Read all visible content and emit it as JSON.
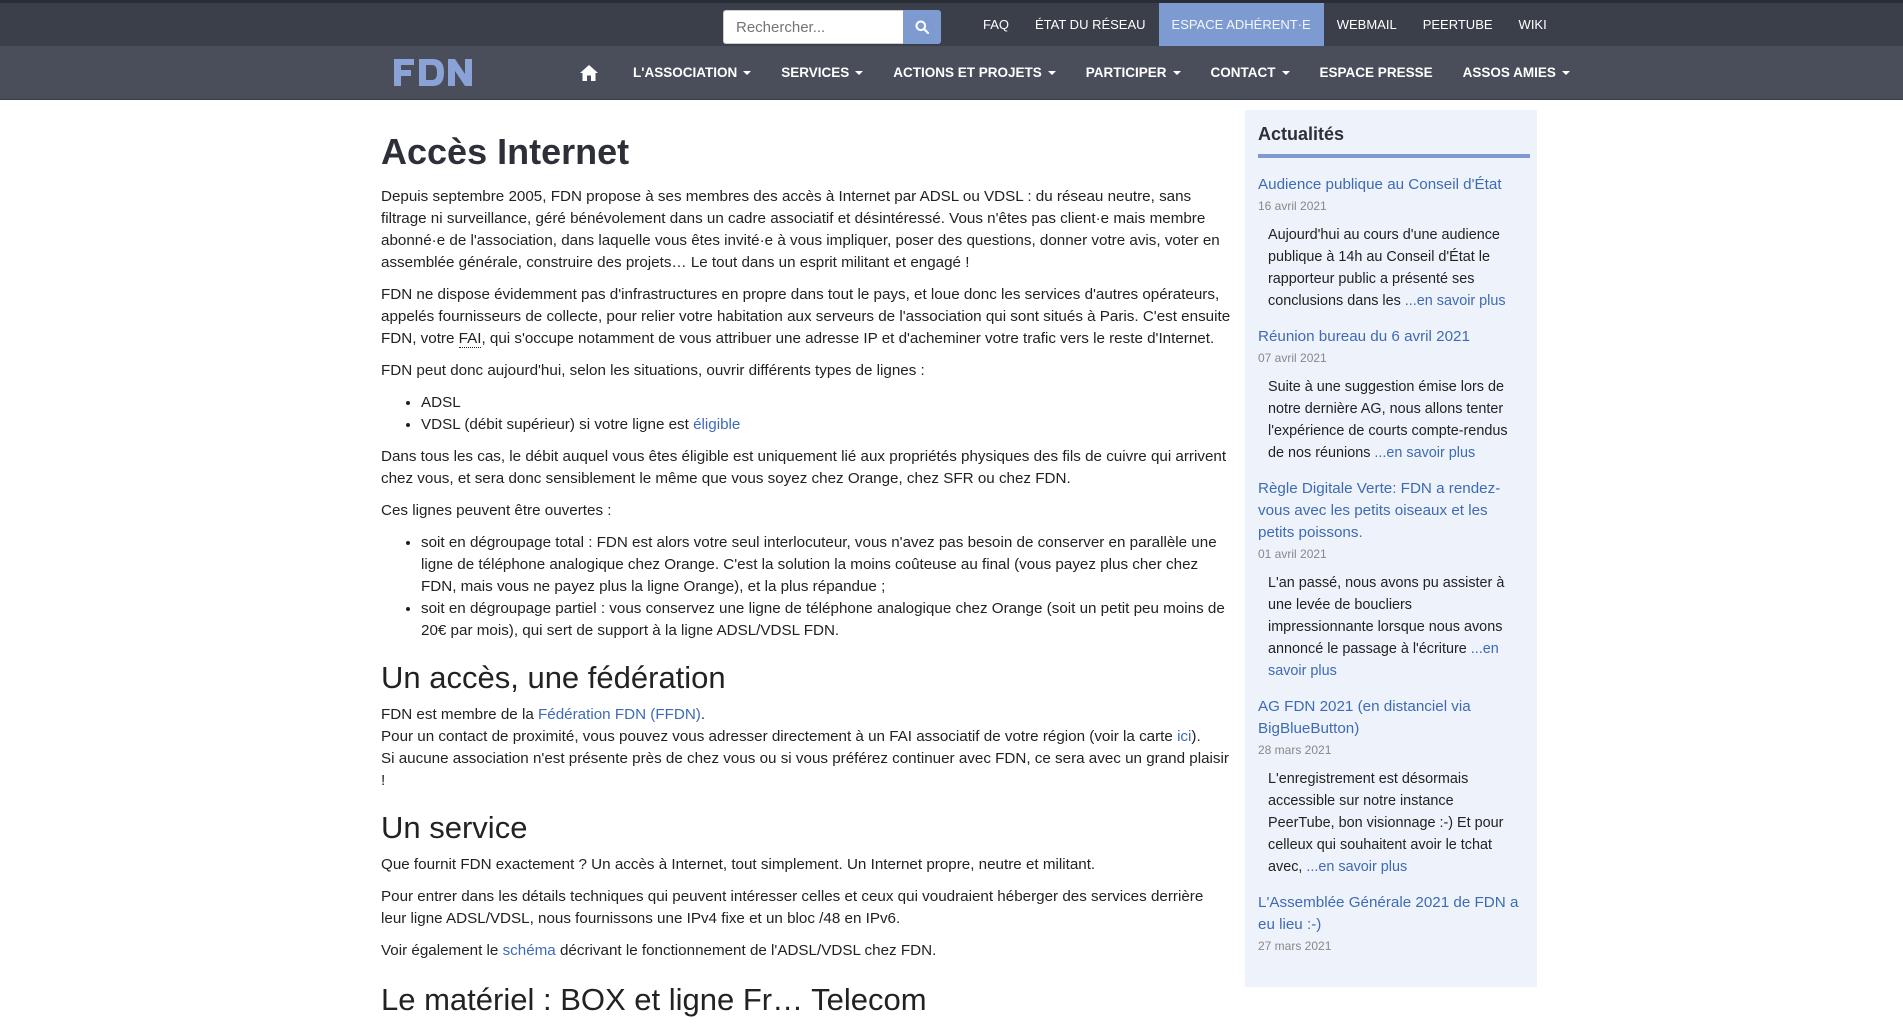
{
  "search": {
    "placeholder": "Rechercher..."
  },
  "toplinks": [
    "FAQ",
    "État du réseau",
    "Espace adhérent·e",
    "Webmail",
    "PeerTube",
    "Wiki"
  ],
  "nav": {
    "logo": "FDN",
    "items": [
      "L'association",
      "Services",
      "Actions et projets",
      "Participer",
      "Contact",
      "Espace presse",
      "Assos amies"
    ]
  },
  "article": {
    "title": "Accès Internet",
    "p1": "Depuis septembre 2005, FDN propose à ses membres des accès à Internet par ADSL ou VDSL : du réseau neutre, sans filtrage ni surveillance, géré bénévolement dans un cadre associatif et désintéressé. Vous n'êtes pas client·e mais membre abonné·e de l'association, dans laquelle vous êtes invité·e à vous impliquer, poser des questions, donner votre avis, voter en assemblée générale, construire des projets… Le tout dans un esprit militant et engagé !",
    "p2a": "FDN ne dispose évidemment pas d'infrastructures en propre dans tout le pays, et loue donc les services d'autres opérateurs, appelés fournisseurs de collecte, pour relier votre habitation aux serveurs de l'association qui sont situés à Paris. C'est ensuite FDN, votre ",
    "p2abbr": "FAI",
    "p2b": ", qui s'occupe notamment de vous attribuer une adresse IP et d'acheminer votre trafic vers le reste d'Internet.",
    "p3": "FDN peut donc aujourd'hui, selon les situations, ouvrir différents types de lignes :",
    "li1": "ADSL",
    "li2a": "VDSL (débit supérieur) si votre ligne est ",
    "li2link": "éligible",
    "p4": "Dans tous les cas, le débit auquel vous êtes éligible est uniquement lié aux propriétés physiques des fils de cuivre qui arrivent chez vous, et sera donc sensiblement le même que vous soyez chez Orange, chez SFR ou chez FDN.",
    "p5": "Ces lignes peuvent être ouvertes :",
    "li3": "soit en dégroupage total : FDN est alors votre seul interlocuteur, vous n'avez pas besoin de conserver en parallèle une ligne de téléphone analogique chez Orange. C'est la solution la moins coûteuse au final (vous payez plus cher chez FDN, mais vous ne payez plus la ligne Orange), et la plus répandue ;",
    "li4": "soit en dégroupage partiel : vous conservez une ligne de téléphone analogique chez Orange (soit un petit peu moins de 20€ par mois), qui sert de support à la ligne ADSL/VDSL FDN.",
    "h2a": "Un accès, une fédération",
    "fed1a": "FDN est membre de la ",
    "fed1link": "Fédération FDN (FFDN)",
    "fed1b": ".",
    "fed2a": "Pour un contact de proximité, vous pouvez vous adresser directement à un FAI associatif de votre région (voir la carte ",
    "fed2link": "ici",
    "fed2b": ").",
    "fed3": "Si aucune association n'est présente près de chez vous ou si vous préférez continuer avec FDN, ce sera avec un grand plaisir !",
    "h2b": "Un service",
    "s1": "Que fournit FDN exactement ? Un accès à Internet, tout simplement. Un Internet propre, neutre et militant.",
    "s2": "Pour entrer dans les détails techniques qui peuvent intéresser celles et ceux qui voudraient héberger des services derrière leur ligne ADSL/VDSL, nous fournissons une IPv4 fixe et un bloc /48 en IPv6.",
    "s3a": "Voir également le ",
    "s3link": "schéma",
    "s3b": " décrivant le fonctionnement de l'ADSL/VDSL chez FDN.",
    "h2c": "Le matériel : BOX et ligne Fr… Telecom"
  },
  "sidebar": {
    "title": "Actualités",
    "more": "...en savoir plus",
    "news": [
      {
        "title": "Audience publique au Conseil d'État",
        "date": "16 avril 2021",
        "text": "Aujourd'hui au cours d'une audience publique à 14h au Conseil d'État le rapporteur public a présenté ses conclusions dans les "
      },
      {
        "title": "Réunion bureau du 6 avril 2021",
        "date": "07 avril 2021",
        "text": "Suite à une suggestion émise lors de notre dernière AG, nous allons tenter l'expérience de courts compte-rendus de nos réunions "
      },
      {
        "title": "Règle Digitale Verte: FDN a rendez-vous avec les petits oiseaux et les petits poissons.",
        "date": "01 avril 2021",
        "text": "L'an passé, nous avons pu assister à une levée de boucliers impressionnante lorsque nous avons annoncé le passage à l'écriture "
      },
      {
        "title": "AG FDN 2021 (en distanciel via BigBlueButton)",
        "date": "28 mars 2021",
        "text": "L'enregistrement est désormais accessible sur notre instance PeerTube, bon visionnage :-) Et pour celleux qui souhaitent avoir le tchat avec, "
      },
      {
        "title": "L'Assemblée Générale 2021 de FDN a eu lieu :-)",
        "date": "27 mars 2021",
        "text": ""
      }
    ]
  }
}
